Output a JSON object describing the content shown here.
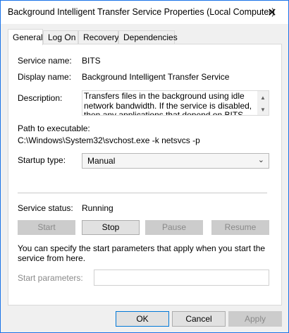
{
  "window": {
    "title": "Background Intelligent Transfer Service Properties (Local Computer)",
    "close_glyph": "✕"
  },
  "tabs": [
    {
      "label": "General",
      "active": true
    },
    {
      "label": "Log On",
      "active": false
    },
    {
      "label": "Recovery",
      "active": false
    },
    {
      "label": "Dependencies",
      "active": false
    }
  ],
  "general": {
    "service_name_label": "Service name:",
    "service_name_value": "BITS",
    "display_name_label": "Display name:",
    "display_name_value": "Background Intelligent Transfer Service",
    "description_label": "Description:",
    "description_value": "Transfers files in the background using idle network bandwidth. If the service is disabled, then any applications that depend on BITS, such as Windows",
    "path_label": "Path to executable:",
    "path_value": "C:\\Windows\\System32\\svchost.exe -k netsvcs -p",
    "startup_type_label": "Startup type:",
    "startup_type_value": "Manual",
    "service_status_label": "Service status:",
    "service_status_value": "Running",
    "start_button": "Start",
    "stop_button": "Stop",
    "pause_button": "Pause",
    "resume_button": "Resume",
    "start_params_hint": "You can specify the start parameters that apply when you start the service from here.",
    "start_params_label": "Start parameters:",
    "start_params_value": ""
  },
  "footer": {
    "ok_button": "OK",
    "cancel_button": "Cancel",
    "apply_button": "Apply"
  }
}
